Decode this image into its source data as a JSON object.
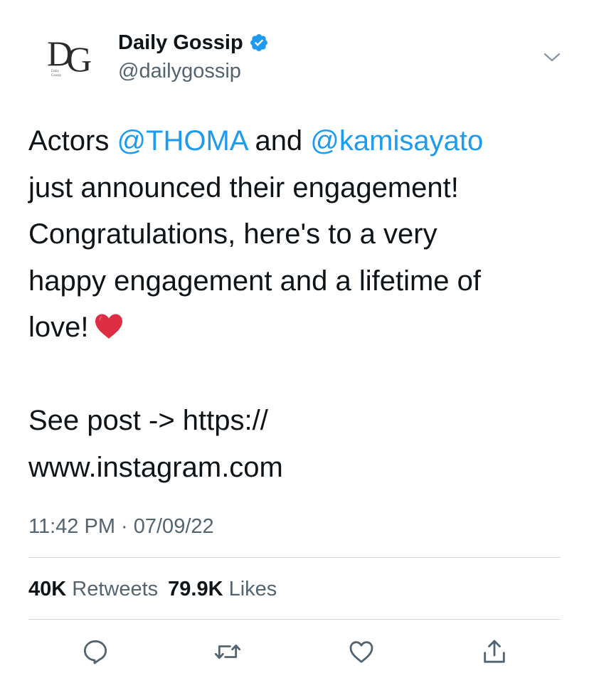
{
  "author": {
    "display_name": "Daily Gossip",
    "handle": "@dailygossip",
    "verified": true,
    "avatar": {
      "letters": "DG",
      "small_text": "Daily Gossip"
    }
  },
  "tweet": {
    "line1": {
      "pre": "Actors ",
      "mention1": "@THOMA",
      "mid": " and ",
      "mention2": "@kamisayato"
    },
    "line2": "just announced their engagement!",
    "line3": "Congratulations, here's to a very",
    "line4": "happy engagement and a lifetime of",
    "line5": "love!",
    "line7": "See post -> https://",
    "line8": "www.instagram.com"
  },
  "timestamp": "11:42 PM · 07/09/22",
  "stats": {
    "retweets_count": "40K",
    "retweets_label": "Retweets",
    "likes_count": "79.9K",
    "likes_label": "Likes"
  },
  "icons": {
    "verified": "verified-badge-icon",
    "chevron": "chevron-down-icon",
    "heart_emoji": "red-heart-emoji",
    "reply": "reply-icon",
    "retweet": "retweet-icon",
    "like": "like-icon",
    "share": "share-icon"
  },
  "colors": {
    "accent": "#1d9bf0",
    "text": "#0f1419",
    "secondary": "#536471",
    "divider": "#cfd9de",
    "heart": "#e0245e"
  }
}
